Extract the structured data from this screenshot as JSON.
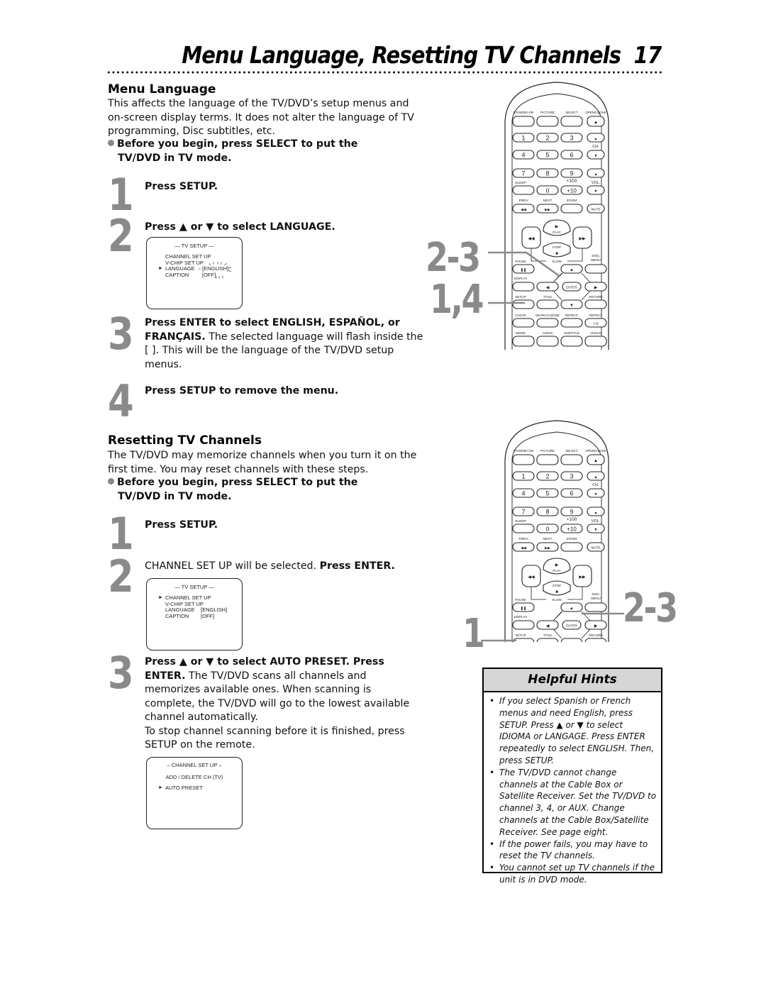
{
  "page": {
    "title": "Menu Language, Resetting TV Channels",
    "page_number": "17"
  },
  "menu_language": {
    "heading": "Menu Language",
    "intro": "This affects the language of the TV/DVD’s setup menus and on-screen display terms. It does not alter the language of TV programming, Disc subtitles, etc.",
    "before_line1": "Before you begin, press SELECT to put the",
    "before_line2": "TV/DVD in TV mode.",
    "steps": [
      {
        "number": "1",
        "bold": "Press SETUP.",
        "text": ""
      },
      {
        "number": "2",
        "bold": "Press ▲ or ▼ to select LANGUAGE.",
        "text": ""
      },
      {
        "number": "3",
        "bold": "Press ENTER to select ENGLISH, ESPAÑOL, or FRANÇAIS.",
        "text": "The selected language will flash inside the [ ]. This will be the language of the TV/DVD setup menus."
      },
      {
        "number": "4",
        "bold": "Press SETUP to remove the menu.",
        "text": ""
      }
    ],
    "screen": {
      "title": "— TV SETUP —",
      "lines": [
        "CHANNEL SET UP",
        "V-CHIP SET UP",
        "LANGUAGE",
        "CAPTION"
      ],
      "values": [
        "",
        "",
        "[ENGLISH]",
        "[OFF]"
      ],
      "selected_marker": "►",
      "selected_index": 2
    }
  },
  "resetting": {
    "heading": "Resetting TV Channels",
    "intro": "The TV/DVD may memorize channels when you turn it on the first time. You may reset channels with these steps.",
    "before_line1": "Before you begin, press SELECT to put the",
    "before_line2": "TV/DVD in TV mode.",
    "steps": [
      {
        "number": "1",
        "bold": "Press SETUP.",
        "text": ""
      },
      {
        "number": "2",
        "pre": "CHANNEL SET UP will be selected.",
        "bold": "Press ENTER.",
        "text": ""
      },
      {
        "number": "3",
        "bold": "Press ▲ or ▼ to select AUTO PRESET. Press ENTER.",
        "text": "The TV/DVD scans all channels and memorizes available ones. When scanning is complete, the TV/DVD will go to the lowest available channel automatically.",
        "note": "To stop channel scanning before it is finished, press SETUP on the remote."
      }
    ],
    "screen1": {
      "title": "— TV SETUP —",
      "lines": [
        "CHANNEL SET UP",
        "V-CHIP SET UP",
        "LANGUAGE",
        "CAPTION"
      ],
      "values": [
        "",
        "",
        "[ENGLISH]",
        "[OFF]"
      ],
      "selected_marker": "►",
      "selected_index": 0
    },
    "screen2": {
      "title": "– CHANNEL SET UP –",
      "lines": [
        "ADD / DELETE CH (TV)",
        "AUTO PRESET"
      ],
      "selected_marker": "►",
      "selected_index": 1
    }
  },
  "helpful_hints": {
    "heading": "Helpful Hints",
    "items": [
      "If you select Spanish or French menus and need English, press SETUP. Press ▲ or ▼ to select IDIOMA or LANGAGE.  Press ENTER repeatedly to select ENGLISH. Then, press SETUP.",
      "The TV/DVD cannot change channels at the Cable Box or Satellite Receiver. Set the TV/DVD to channel 3, 4, or AUX. Change channels at the Cable Box/Satellite Receiver. See page eight.",
      "If the power fails, you may have to reset the TV channels.",
      "You cannot set up TV channels if the unit is in DVD mode."
    ]
  },
  "remote": {
    "top_labels": [
      "STANDBY-ON",
      "PICTURE",
      "SELECT",
      "OPEN/CLOSE"
    ],
    "numbers": [
      "1",
      "2",
      "3",
      "4",
      "5",
      "6",
      "7",
      "8",
      "9",
      "0",
      "+10"
    ],
    "ch_label": "CH.",
    "vol_label": "VOL.",
    "sleep_label": "SLEEP",
    "plus100_label": "+100",
    "prev_label": "PREV",
    "next_label": "NEXT",
    "zoom_label": "ZOOM",
    "mute_label": "MUTE",
    "play_label": "PLAY",
    "stop_label": "STOP",
    "slow_label": "SLOW",
    "pause_label": "PAUSE",
    "disc_label": "DISC",
    "menu_label": "MENU",
    "display_label": "DISPLAY",
    "enter_label": "ENTER",
    "setup_label": "SETUP",
    "title_label": "TITLE",
    "return_label": "RETURN",
    "clear_label": "CLEAR",
    "search_label": "SEARCH MODE",
    "repeat_label": "REPEAT",
    "ab_label": "A-B",
    "mode_label": "MODE",
    "audio_label": "AUDIO",
    "subtitle_label": "SUBTITLE",
    "angle_label": "ANGLE"
  },
  "callouts": {
    "top_a": "2-3",
    "top_b": "1,4",
    "bottom_a": "2-3",
    "bottom_b": "1"
  }
}
